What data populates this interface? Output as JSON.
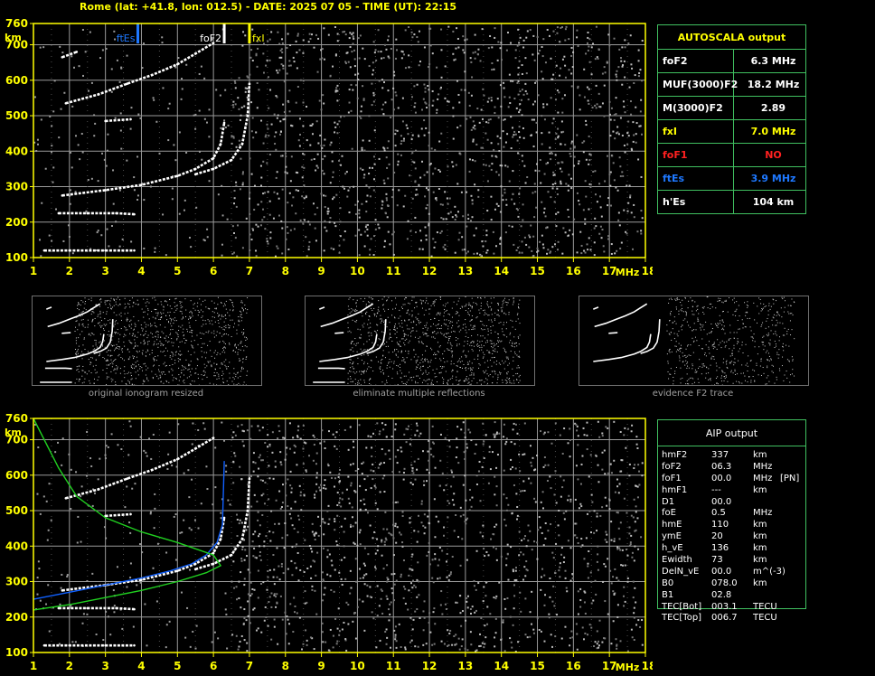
{
  "header": "Rome (lat: +41.8, lon: 012.5) - DATE: 2025 07 05 - TIME (UT): 22:15",
  "colors": {
    "axis": "#ffff00",
    "grid": "#9a9a9a",
    "trace": "#ffffff",
    "foes": "#1e78ff",
    "fxi": "#ffff00",
    "fof2": "#ffffff",
    "profile": "#1060ff",
    "model": "#20d020",
    "tableBorder": "#40c060"
  },
  "chart_data": [
    {
      "type": "scatter",
      "name": "ionogram-autoscala",
      "xlabel": "MHz",
      "ylabel": "km",
      "xlim": [
        1,
        18
      ],
      "ylim": [
        100,
        760
      ],
      "xticks": [
        "1",
        "2",
        "3",
        "4",
        "5",
        "6",
        "7",
        "8",
        "9",
        "10",
        "11",
        "12",
        "13",
        "14",
        "15",
        "16",
        "17",
        "18"
      ],
      "yticks": [
        "100",
        "200",
        "300",
        "400",
        "500",
        "600",
        "700",
        "760"
      ],
      "grid": true,
      "markers": [
        {
          "label": "ftEs",
          "x": 3.9,
          "color": "#1e78ff"
        },
        {
          "label": "foF2",
          "x": 6.3,
          "color": "#ffffff"
        },
        {
          "label": "fxI",
          "x": 7.0,
          "color": "#ffff00"
        }
      ],
      "series": [
        {
          "points": [
            [
              1.3,
              120
            ],
            [
              2,
              120
            ],
            [
              3,
              120
            ],
            [
              3.8,
              120
            ]
          ]
        },
        {
          "points": [
            [
              1.7,
              225
            ],
            [
              2.5,
              225
            ],
            [
              3.3,
              225
            ],
            [
              3.8,
              222
            ]
          ]
        },
        {
          "points": [
            [
              1.8,
              275
            ],
            [
              3,
              290
            ],
            [
              4,
              305
            ],
            [
              5,
              330
            ],
            [
              5.5,
              350
            ],
            [
              6,
              380
            ],
            [
              6.2,
              420
            ],
            [
              6.3,
              480
            ]
          ]
        },
        {
          "points": [
            [
              5.5,
              335
            ],
            [
              6,
              350
            ],
            [
              6.5,
              375
            ],
            [
              6.8,
              420
            ],
            [
              6.95,
              500
            ],
            [
              7,
              590
            ]
          ]
        },
        {
          "points": [
            [
              1.9,
              535
            ],
            [
              2.8,
              560
            ],
            [
              3.6,
              590
            ],
            [
              4.3,
              615
            ],
            [
              5,
              645
            ],
            [
              5.5,
              675
            ],
            [
              6,
              705
            ]
          ]
        },
        {
          "points": [
            [
              1.8,
              665
            ],
            [
              2.2,
              680
            ]
          ]
        },
        {
          "points": [
            [
              3,
              485
            ],
            [
              3.7,
              490
            ]
          ]
        }
      ]
    },
    {
      "type": "scatter",
      "name": "ionogram-aip",
      "xlabel": "MHz",
      "ylabel": "km",
      "xlim": [
        1,
        18
      ],
      "ylim": [
        100,
        760
      ],
      "xticks": [
        "1",
        "2",
        "3",
        "4",
        "5",
        "6",
        "7",
        "8",
        "9",
        "10",
        "11",
        "12",
        "13",
        "14",
        "15",
        "16",
        "17",
        "18"
      ],
      "yticks": [
        "100",
        "200",
        "300",
        "400",
        "500",
        "600",
        "700",
        "760"
      ],
      "grid": true,
      "series": [
        {
          "points": [
            [
              1.3,
              120
            ],
            [
              2,
              120
            ],
            [
              3,
              120
            ],
            [
              3.8,
              120
            ]
          ]
        },
        {
          "points": [
            [
              1.7,
              225
            ],
            [
              2.5,
              225
            ],
            [
              3.3,
              225
            ],
            [
              3.8,
              222
            ]
          ]
        },
        {
          "points": [
            [
              1.8,
              275
            ],
            [
              3,
              290
            ],
            [
              4,
              305
            ],
            [
              5,
              330
            ],
            [
              5.5,
              350
            ],
            [
              6,
              380
            ],
            [
              6.2,
              420
            ],
            [
              6.3,
              480
            ]
          ]
        },
        {
          "points": [
            [
              5.5,
              335
            ],
            [
              6,
              350
            ],
            [
              6.5,
              375
            ],
            [
              6.8,
              420
            ],
            [
              6.95,
              500
            ],
            [
              7,
              590
            ]
          ]
        },
        {
          "points": [
            [
              1.9,
              535
            ],
            [
              2.8,
              560
            ],
            [
              3.6,
              590
            ],
            [
              4.3,
              615
            ],
            [
              5,
              645
            ],
            [
              5.5,
              675
            ],
            [
              6,
              705
            ]
          ]
        },
        {
          "points": [
            [
              3,
              485
            ],
            [
              3.7,
              490
            ]
          ]
        },
        {
          "points": [
            [
              1,
              250
            ],
            [
              2,
              270
            ],
            [
              3,
              290
            ],
            [
              4,
              310
            ],
            [
              4.8,
              330
            ],
            [
              5.4,
              350
            ],
            [
              5.8,
              375
            ],
            [
              6.1,
              410
            ],
            [
              6.25,
              460
            ],
            [
              6.3,
              640
            ]
          ],
          "color": "#1060ff"
        },
        {
          "points": [
            [
              1,
              220
            ],
            [
              2,
              235
            ],
            [
              3,
              255
            ],
            [
              4,
              275
            ],
            [
              5,
              300
            ],
            [
              5.8,
              325
            ],
            [
              6.2,
              345
            ],
            [
              6,
              375
            ],
            [
              5,
              410
            ],
            [
              4,
              440
            ],
            [
              3,
              480
            ],
            [
              2.2,
              540
            ],
            [
              1.7,
              620
            ],
            [
              1.3,
              700
            ],
            [
              1,
              760
            ]
          ],
          "color": "#20d020"
        }
      ]
    }
  ],
  "thumbnails": {
    "captions": [
      "original ionogram resized",
      "eliminate multiple reflections",
      "evidence F2 trace"
    ]
  },
  "autoscala": {
    "title": "AUTOSCALA output",
    "rows": [
      {
        "label": "foF2",
        "value": "6.3 MHz",
        "color": "#ffffff"
      },
      {
        "label": "MUF(3000)F2",
        "value": "18.2 MHz",
        "color": "#ffffff"
      },
      {
        "label": "M(3000)F2",
        "value": "2.89",
        "color": "#ffffff"
      },
      {
        "label": "fxI",
        "value": "7.0 MHz",
        "color": "#ffff00"
      },
      {
        "label": "foF1",
        "value": "NO",
        "color": "#ff2020"
      },
      {
        "label": "ftEs",
        "value": "3.9 MHz",
        "color": "#1e78ff"
      },
      {
        "label": "h'Es",
        "value": "104    km",
        "color": "#ffffff"
      }
    ]
  },
  "aip": {
    "title": "AIP output",
    "rows": [
      {
        "name": "hmF2",
        "val": "337",
        "unit": "km",
        "extra": ""
      },
      {
        "name": "foF2",
        "val": "06.3",
        "unit": "MHz",
        "extra": ""
      },
      {
        "name": "foF1",
        "val": "00.0",
        "unit": "MHz",
        "extra": "[PN]"
      },
      {
        "name": "hmF1",
        "val": "---",
        "unit": "km",
        "extra": ""
      },
      {
        "name": "D1",
        "val": "00.0",
        "unit": "",
        "extra": ""
      },
      {
        "name": "foE",
        "val": "0.5",
        "unit": "MHz",
        "extra": ""
      },
      {
        "name": "hmE",
        "val": "110",
        "unit": "km",
        "extra": ""
      },
      {
        "name": "ymE",
        "val": "20",
        "unit": "km",
        "extra": ""
      },
      {
        "name": "h_vE",
        "val": "136",
        "unit": "km",
        "extra": ""
      },
      {
        "name": "Ewidth",
        "val": "73",
        "unit": "km",
        "extra": ""
      },
      {
        "name": "DelN_vE",
        "val": "00.0",
        "unit": "m^(-3)",
        "extra": ""
      },
      {
        "name": "B0",
        "val": "078.0",
        "unit": "km",
        "extra": ""
      },
      {
        "name": "B1",
        "val": "02.8",
        "unit": "",
        "extra": ""
      },
      {
        "name": "TEC[Bot]",
        "val": "003.1",
        "unit": "TECU",
        "extra": ""
      },
      {
        "name": "TEC[Top]",
        "val": "006.7",
        "unit": "TECU",
        "extra": ""
      }
    ]
  }
}
